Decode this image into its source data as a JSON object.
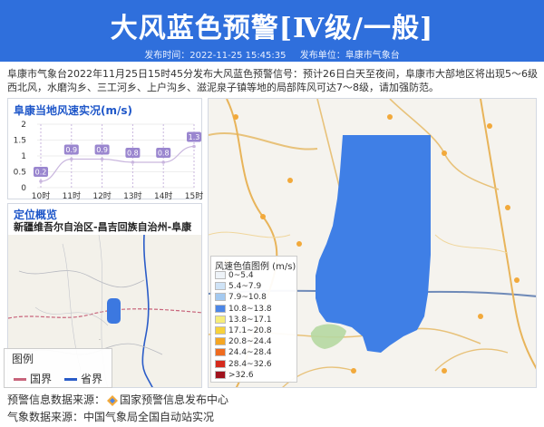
{
  "header": {
    "title": "大风蓝色预警[Ⅳ级/一般]",
    "publish_time_label": "发布时间：2022-11-25 15:45:35",
    "publisher_label": "发布单位：阜康市气象台",
    "bg_color": "#2f6fdc"
  },
  "intro": "阜康市气象台2022年11月25日15时45分发布大风蓝色预警信号：预计26日白天至夜间，阜康市大部地区将出现5～6级西北风，水磨沟乡、三工河乡、上户沟乡、滋泥泉子镇等地的局部阵风可达7～8级，请加强防范。",
  "wind_card": {
    "title": "阜康当地风速实况(m/s)"
  },
  "chart_data": {
    "type": "line",
    "title": "阜康当地风速实况(m/s)",
    "categories": [
      "10时",
      "11时",
      "12时",
      "13时",
      "14时",
      "15时"
    ],
    "series": [
      {
        "values": [
          0.2,
          0.9,
          0.9,
          0.8,
          0.8,
          1.3
        ]
      }
    ],
    "data_labels": [
      "0.2",
      "0.9",
      "0.9",
      "0.8",
      "0.8",
      "1.3"
    ],
    "yticks": [
      "0",
      "0.5",
      "1",
      "1.5",
      "2"
    ],
    "ylim": [
      0,
      2
    ],
    "grid": true,
    "line_color": "#c9b6de",
    "label_color": "#9a86cf"
  },
  "location": {
    "title": "定位概览",
    "region": "新疆维吾尔自治区-昌吉回族自治州-阜康市",
    "legend_title": "图例",
    "legend_items": [
      {
        "label": "国界",
        "color": "#c8647b"
      },
      {
        "label": "省界",
        "color": "#2a5cc8"
      }
    ]
  },
  "wind_legend": {
    "title": "风速色值图例 (m/s)",
    "items": [
      {
        "label": "0~5.4",
        "color": "#eef3f8"
      },
      {
        "label": "5.4~7.9",
        "color": "#cfe3f6"
      },
      {
        "label": "7.9~10.8",
        "color": "#a3c9f0"
      },
      {
        "label": "10.8~13.8",
        "color": "#4c86e6"
      },
      {
        "label": "13.8~17.1",
        "color": "#f6ed7a"
      },
      {
        "label": "17.1~20.8",
        "color": "#f7d23c"
      },
      {
        "label": "20.8~24.4",
        "color": "#f5a623"
      },
      {
        "label": "24.4~28.4",
        "color": "#ef6b1f"
      },
      {
        "label": "28.4~32.6",
        "color": "#d52a1c"
      },
      {
        "label": ">32.6",
        "color": "#a0121c"
      }
    ]
  },
  "sources": {
    "warning_label": "预警信息数据来源：",
    "warning_source": "国家预警信息发布中心",
    "weather_label": "气象数据来源：",
    "weather_source": "中国气象局全国自动站实况"
  }
}
